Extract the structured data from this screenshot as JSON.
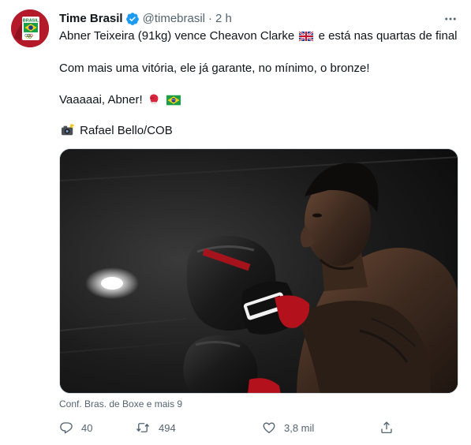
{
  "tweet": {
    "author_name": "Time Brasil",
    "handle": "@timebrasil",
    "separator": "·",
    "time": "2 h",
    "lines": [
      "Abner Teixeira (91kg) vence Cheavon Clarke",
      "e está nas quartas de final",
      "Com mais uma vitória, ele já garante, no mínimo, o bronze!",
      "Vaaaaai, Abner!",
      "Rafael Bello/COB"
    ],
    "emojis": [
      "uk-flag-emoji",
      "boxing-glove-emoji",
      "brazil-flag-emoji",
      "camera-flash-emoji"
    ],
    "media_tagline": "Conf. Bras. de Boxe e mais 9",
    "avatar_label": "BRASIL"
  },
  "actions": {
    "reply_count": "40",
    "retweet_count": "494",
    "like_count": "3,8 mil"
  },
  "icons": [
    "verified-badge-icon",
    "more-icon",
    "reply-icon",
    "retweet-icon",
    "like-icon",
    "share-icon"
  ],
  "colors": {
    "brand_blue": "#1d9bf0",
    "secondary_text": "#536471",
    "avatar_red": "#b31b2b",
    "glove_red": "#b3121c"
  }
}
